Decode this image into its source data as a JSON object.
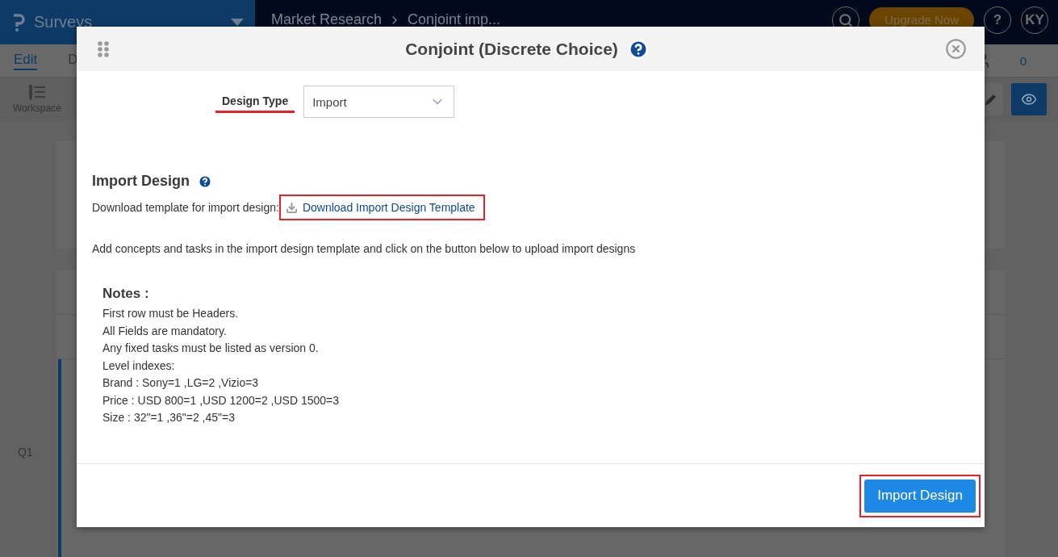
{
  "app_header": {
    "product": "Surveys",
    "breadcrumb": [
      "Market Research",
      "Conjoint imp..."
    ],
    "upgrade_button": "Upgrade Now",
    "help": "?",
    "avatar": "KY"
  },
  "nav_tabs": [
    {
      "label": "Edit",
      "selected": true
    },
    {
      "label": "D",
      "selected": false
    }
  ],
  "respondents_count": "0",
  "toolbar": {
    "workspace": "Workspace"
  },
  "question_label": "Q1",
  "dialog": {
    "title": "Conjoint (Discrete Choice)",
    "design_type": {
      "label": "Design Type",
      "value": "Import",
      "highlighted": true
    },
    "section_title": "Import Design",
    "download_prompt": "Download template for import design:",
    "download_link": {
      "label": "Download Import Design Template",
      "highlighted": true
    },
    "instructions": "Add concepts and tasks in the import design template and click on the button below to upload import designs",
    "notes_title": "Notes :",
    "notes": [
      "First row must be Headers.",
      "All Fields are mandatory.",
      "Any fixed tasks must be listed as version 0.",
      "Level indexes:",
      "Brand : Sony=1 ,LG=2 ,Vizio=3",
      "Price : USD 800=1 ,USD 1200=2 ,USD 1500=3",
      "Size : 32\"=1 ,36\"=2 ,45\"=3"
    ],
    "primary_button": {
      "label": "Import Design",
      "highlighted": true
    }
  }
}
